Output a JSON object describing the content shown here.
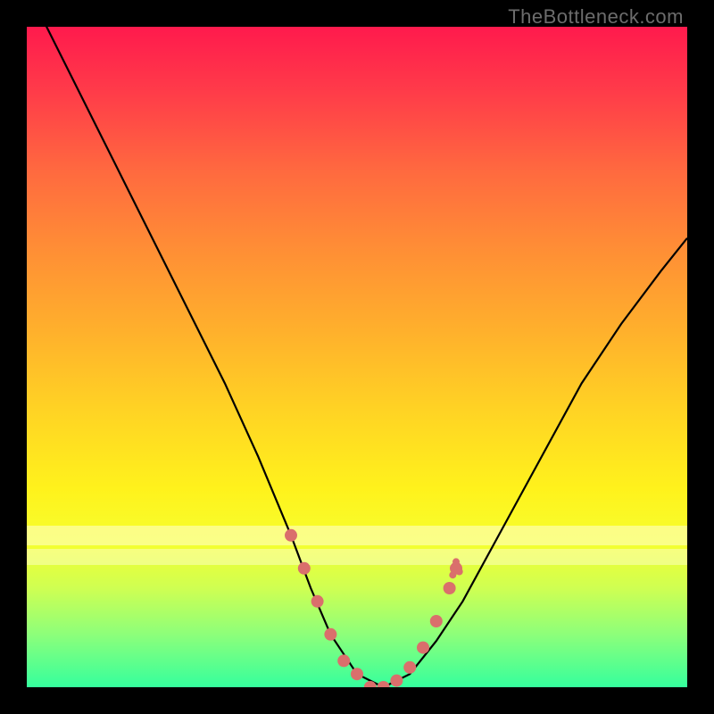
{
  "watermark": "TheBottleneck.com",
  "colors": {
    "frame": "#000000",
    "curve": "#000000",
    "dot": "#da6f6c",
    "gradient_top": "#ff1a4d",
    "gradient_bottom": "#35ff9d"
  },
  "chart_data": {
    "type": "line",
    "title": "",
    "xlabel": "",
    "ylabel": "",
    "xlim": [
      0,
      1
    ],
    "ylim": [
      0,
      1
    ],
    "grid": false,
    "legend": false,
    "series": [
      {
        "name": "curve",
        "x": [
          0.0,
          0.05,
          0.1,
          0.15,
          0.2,
          0.25,
          0.3,
          0.35,
          0.4,
          0.43,
          0.46,
          0.5,
          0.54,
          0.58,
          0.62,
          0.66,
          0.72,
          0.78,
          0.84,
          0.9,
          0.96,
          1.0
        ],
        "y": [
          1.06,
          0.96,
          0.86,
          0.76,
          0.66,
          0.56,
          0.46,
          0.35,
          0.23,
          0.15,
          0.08,
          0.02,
          0.0,
          0.02,
          0.07,
          0.13,
          0.24,
          0.35,
          0.46,
          0.55,
          0.63,
          0.68
        ]
      }
    ],
    "highlight_dots": {
      "name": "near-zero-markers",
      "x": [
        0.4,
        0.42,
        0.44,
        0.46,
        0.48,
        0.5,
        0.52,
        0.54,
        0.56,
        0.58,
        0.6,
        0.62,
        0.64,
        0.65
      ],
      "y": [
        0.23,
        0.18,
        0.13,
        0.08,
        0.04,
        0.02,
        0.0,
        0.0,
        0.01,
        0.03,
        0.06,
        0.1,
        0.15,
        0.18
      ]
    },
    "yellow_bands": [
      {
        "y0": 0.215,
        "y1": 0.245
      },
      {
        "y0": 0.185,
        "y1": 0.21
      }
    ]
  }
}
